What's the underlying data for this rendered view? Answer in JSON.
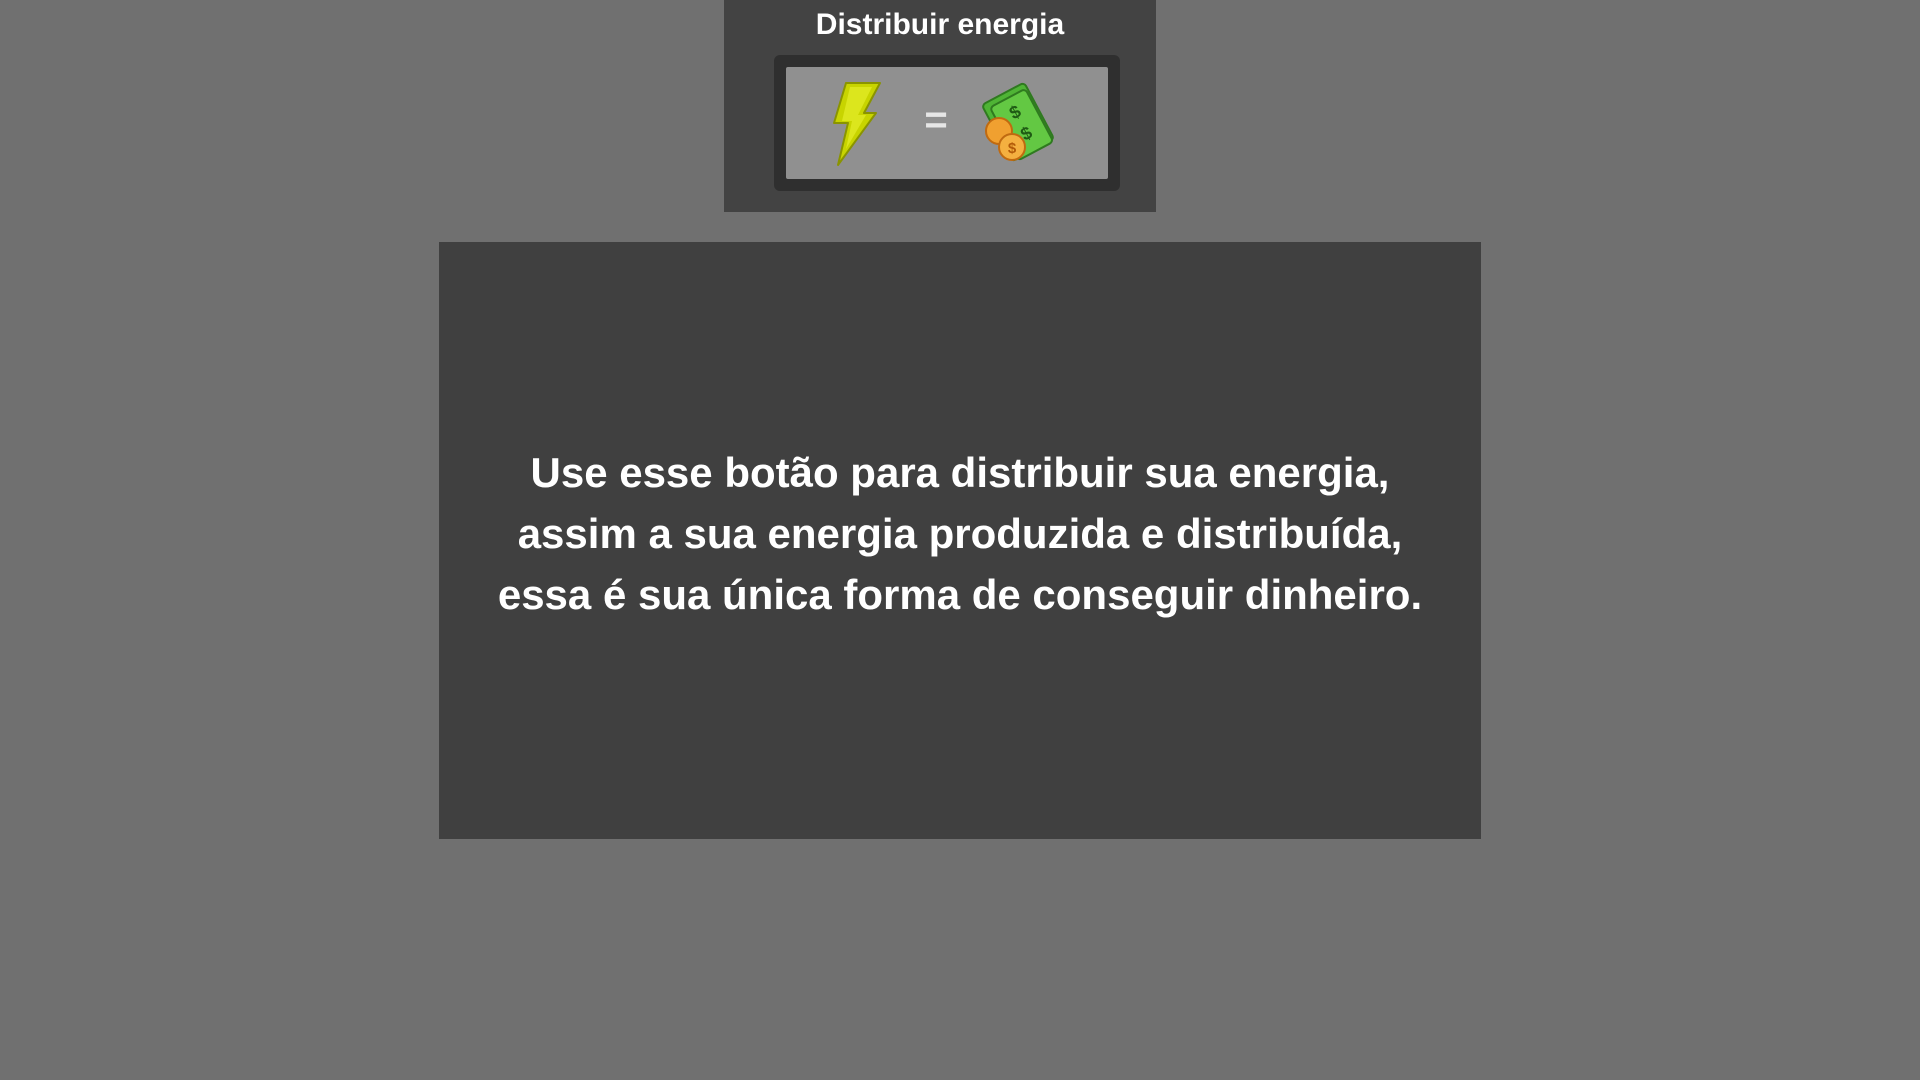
{
  "distribute_panel": {
    "title": "Distribuir energia",
    "button": {
      "left_icon": "lightning-bolt-icon",
      "operator": "=",
      "right_icon": "money-icon"
    }
  },
  "tutorial": {
    "message": "Use esse botão para distribuir sua energia, assim a sua energia produzida e distribuída, essa é sua única forma de conseguir dinheiro."
  },
  "colors": {
    "background": "#707070",
    "panel": "#434343",
    "message_box": "#404040",
    "button_frame": "#2f2f2f",
    "button_face": "#909090",
    "bolt": "#c8d400",
    "money": "#5cc23d",
    "coin": "#f0a030"
  }
}
